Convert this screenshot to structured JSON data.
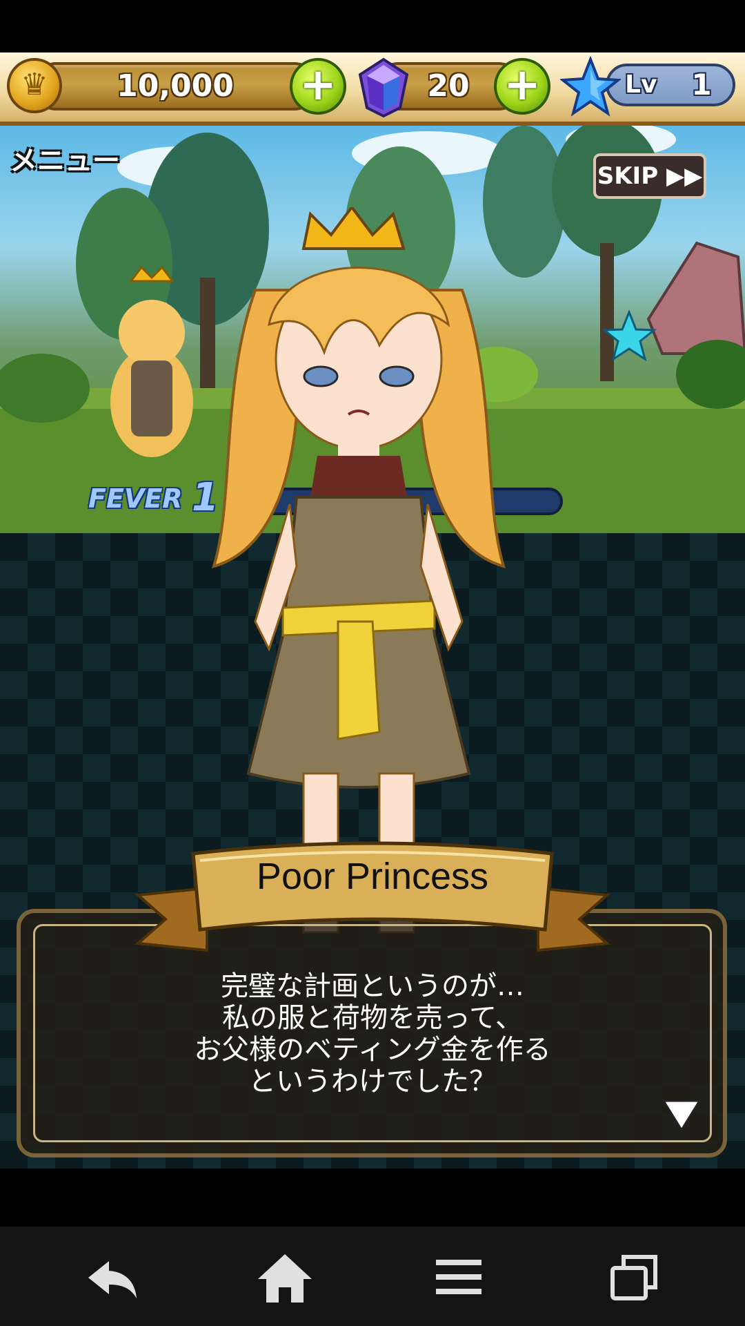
{
  "resources": {
    "coins": "10,000",
    "gems": "20",
    "level_label": "Lv",
    "level_value": "1"
  },
  "scene": {
    "menu_label": "メニュー",
    "skip_label": "SKIP ▶▶",
    "fever_label": "FEVER",
    "fever_value": "1"
  },
  "dialogue": {
    "speaker": "Poor Princess",
    "text": "完璧な計画というのが…\n私の服と荷物を売って、\nお父様のベティング金を作る\nというわけでした？"
  },
  "icons": {
    "coin": "coin-icon",
    "gem": "gem-icon",
    "level": "star-icon",
    "next": "triangle-down-icon",
    "nav": [
      "back-icon",
      "home-icon",
      "menu-icon",
      "recent-apps-icon"
    ]
  },
  "colors": {
    "gold": "#c9a049",
    "plus_green": "#9ed51a",
    "board": "#14323a"
  }
}
